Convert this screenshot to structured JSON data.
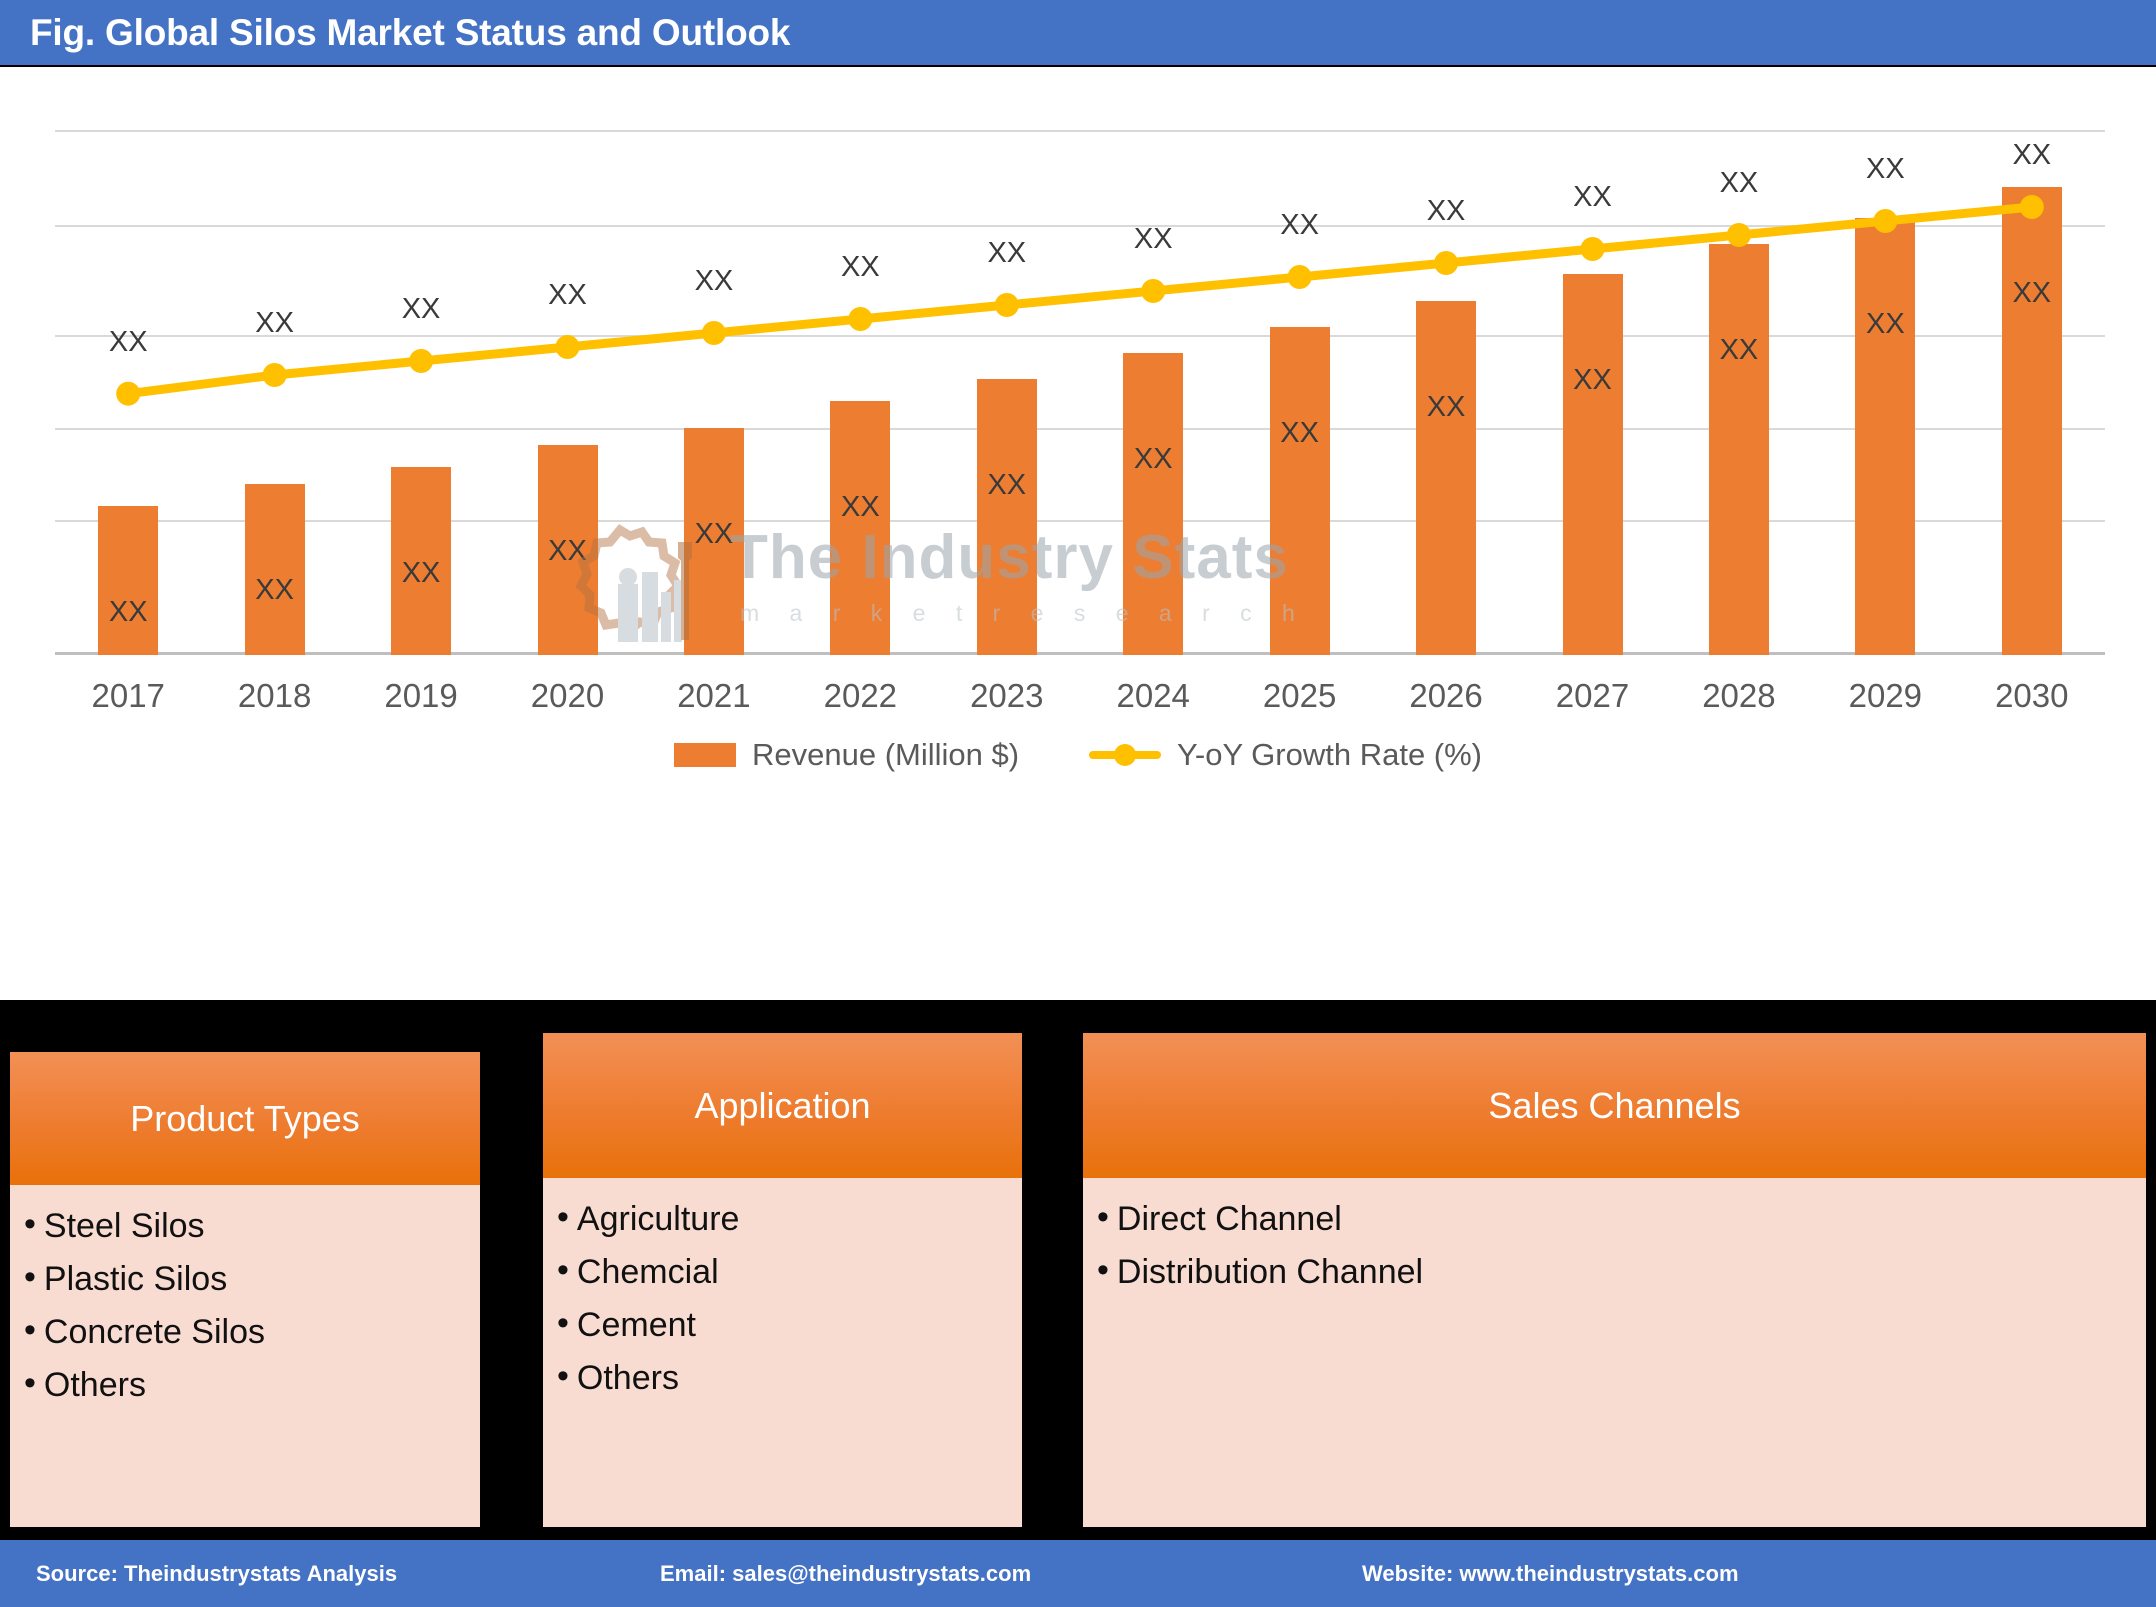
{
  "header": {
    "title": "Fig. Global Silos Market Status and Outlook"
  },
  "colors": {
    "header_bar": "#4472C4",
    "bar_series": "#ED7D31",
    "line_series": "#FFC000",
    "box_header": "#ED7D31",
    "box_body": "#F8DCD2",
    "panel_background": "#000000"
  },
  "watermark": {
    "title": "The Industry Stats",
    "subtitle": "m a r k e t   r e s e a r c h"
  },
  "chart_data": {
    "type": "bar",
    "title": "Fig. Global Silos Market Status and Outlook",
    "xlabel": "",
    "ylabel": "",
    "grid": true,
    "legend_position": "bottom",
    "categories": [
      "2017",
      "2018",
      "2019",
      "2020",
      "2021",
      "2022",
      "2023",
      "2024",
      "2025",
      "2026",
      "2027",
      "2028",
      "2029",
      "2030"
    ],
    "bar_value_labels": [
      "XX",
      "XX",
      "XX",
      "XX",
      "XX",
      "XX",
      "XX",
      "XX",
      "XX",
      "XX",
      "XX",
      "XX",
      "XX",
      "XX"
    ],
    "line_value_labels": [
      "XX",
      "XX",
      "XX",
      "XX",
      "XX",
      "XX",
      "XX",
      "XX",
      "XX",
      "XX",
      "XX",
      "XX",
      "XX",
      "XX"
    ],
    "series": [
      {
        "name": "Revenue (Million $)",
        "type": "bar",
        "color": "#ED7D31",
        "axis": "left",
        "values": [
          34,
          39,
          43,
          48,
          52,
          58,
          63,
          69,
          75,
          81,
          87,
          94,
          100,
          107
        ]
      },
      {
        "name": "Y-oY Growth Rate (%)",
        "type": "line",
        "color": "#FFC000",
        "axis": "right",
        "values": [
          56,
          60,
          63,
          66,
          69,
          72,
          75,
          78,
          81,
          84,
          87,
          90,
          93,
          96
        ]
      }
    ],
    "legend": [
      "Revenue (Million $)",
      "Y-oY Growth Rate (%)"
    ]
  },
  "segments": [
    {
      "title": "Product Types",
      "items": [
        "Steel Silos",
        "Plastic Silos",
        "Concrete Silos",
        "Others"
      ]
    },
    {
      "title": "Application",
      "items": [
        "Agriculture",
        "Chemcial",
        "Cement",
        "Others"
      ]
    },
    {
      "title": "Sales Channels",
      "items": [
        "Direct Channel",
        "Distribution Channel"
      ]
    }
  ],
  "footer": {
    "source": "Source: Theindustrystats Analysis",
    "email": "Email: sales@theindustrystats.com",
    "website": "Website: www.theindustrystats.com"
  }
}
